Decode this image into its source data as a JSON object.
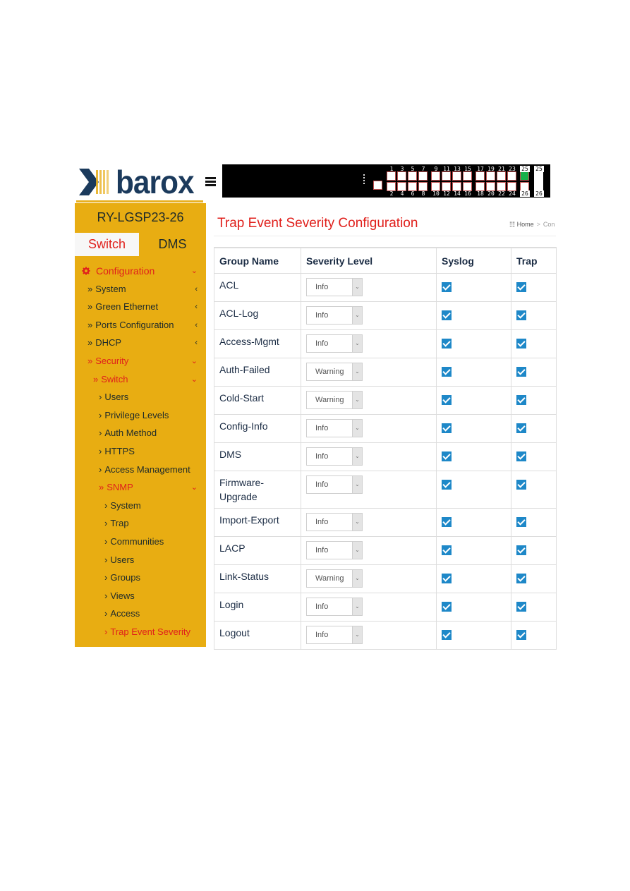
{
  "header": {
    "logo_text": "barox",
    "menu_icon": "hamburger-icon",
    "switch_panel": {
      "top_port_labels": [
        "1",
        "3",
        "5",
        "7",
        "9",
        "11",
        "13",
        "15",
        "17",
        "19",
        "21",
        "23",
        "25",
        "25"
      ],
      "bottom_port_labels": [
        "2",
        "4",
        "6",
        "8",
        "10",
        "12",
        "14",
        "16",
        "18",
        "20",
        "22",
        "24",
        "26",
        "26"
      ],
      "link_up_ports": [
        "25"
      ]
    }
  },
  "sidebar": {
    "device_name": "RY-LGSP23-26",
    "tabs": [
      {
        "label": "Switch",
        "active": true
      },
      {
        "label": "DMS",
        "active": false
      }
    ],
    "items": [
      {
        "label": "Configuration",
        "level": 0,
        "active": true,
        "icon": "gear-icon",
        "chevron": "chevron-down-icon"
      },
      {
        "label": "System",
        "level": 1,
        "active": false,
        "prefix": "»",
        "chevron": "chevron-left-icon"
      },
      {
        "label": "Green Ethernet",
        "level": 1,
        "active": false,
        "prefix": "»",
        "chevron": "chevron-left-icon"
      },
      {
        "label": "Ports Configuration",
        "level": 1,
        "active": false,
        "prefix": "»",
        "chevron": "chevron-left-icon"
      },
      {
        "label": "DHCP",
        "level": 1,
        "active": false,
        "prefix": "»",
        "chevron": "chevron-left-icon"
      },
      {
        "label": "Security",
        "level": 1,
        "active": true,
        "prefix": "»",
        "chevron": "chevron-down-icon"
      },
      {
        "label": "Switch",
        "level": 2,
        "active": true,
        "prefix": "»",
        "chevron": "chevron-down-icon"
      },
      {
        "label": "Users",
        "level": 3,
        "active": false,
        "prefix": "›"
      },
      {
        "label": "Privilege Levels",
        "level": 3,
        "active": false,
        "prefix": "›"
      },
      {
        "label": "Auth Method",
        "level": 3,
        "active": false,
        "prefix": "›"
      },
      {
        "label": "HTTPS",
        "level": 3,
        "active": false,
        "prefix": "›"
      },
      {
        "label": "Access Management",
        "level": 3,
        "active": false,
        "prefix": "›"
      },
      {
        "label": "SNMP",
        "level": 3,
        "active": true,
        "prefix": "»",
        "chevron": "chevron-down-icon"
      },
      {
        "label": "System",
        "level": 4,
        "active": false,
        "prefix": "›"
      },
      {
        "label": "Trap",
        "level": 4,
        "active": false,
        "prefix": "›"
      },
      {
        "label": "Communities",
        "level": 4,
        "active": false,
        "prefix": "›"
      },
      {
        "label": "Users",
        "level": 4,
        "active": false,
        "prefix": "›"
      },
      {
        "label": "Groups",
        "level": 4,
        "active": false,
        "prefix": "›"
      },
      {
        "label": "Views",
        "level": 4,
        "active": false,
        "prefix": "›"
      },
      {
        "label": "Access",
        "level": 4,
        "active": false,
        "prefix": "›"
      },
      {
        "label": "Trap Event Severity",
        "level": 4,
        "active": true,
        "prefix": "›"
      }
    ]
  },
  "main": {
    "title": "Trap Event Severity Configuration",
    "breadcrumb": {
      "home": "Home",
      "separator": ">",
      "current": "Con"
    },
    "table": {
      "columns": [
        "Group Name",
        "Severity Level",
        "Syslog",
        "Trap"
      ],
      "rows": [
        {
          "group": "ACL",
          "severity": "Info",
          "syslog": true,
          "trap": true
        },
        {
          "group": "ACL-Log",
          "severity": "Info",
          "syslog": true,
          "trap": true
        },
        {
          "group": "Access-Mgmt",
          "severity": "Info",
          "syslog": true,
          "trap": true
        },
        {
          "group": "Auth-Failed",
          "severity": "Warning",
          "syslog": true,
          "trap": true
        },
        {
          "group": "Cold-Start",
          "severity": "Warning",
          "syslog": true,
          "trap": true
        },
        {
          "group": "Config-Info",
          "severity": "Info",
          "syslog": true,
          "trap": true
        },
        {
          "group": "DMS",
          "severity": "Info",
          "syslog": true,
          "trap": true
        },
        {
          "group": "Firmware-Upgrade",
          "severity": "Info",
          "syslog": true,
          "trap": true
        },
        {
          "group": "Import-Export",
          "severity": "Info",
          "syslog": true,
          "trap": true
        },
        {
          "group": "LACP",
          "severity": "Info",
          "syslog": true,
          "trap": true
        },
        {
          "group": "Link-Status",
          "severity": "Warning",
          "syslog": true,
          "trap": true
        },
        {
          "group": "Login",
          "severity": "Info",
          "syslog": true,
          "trap": true
        },
        {
          "group": "Logout",
          "severity": "Info",
          "syslog": true,
          "trap": true
        }
      ]
    }
  },
  "colors": {
    "sidebar_bg": "#e8ad12",
    "accent_red": "#e0201c",
    "checkbox_blue": "#1e88c8",
    "logo_navy": "#1b3a5c"
  }
}
